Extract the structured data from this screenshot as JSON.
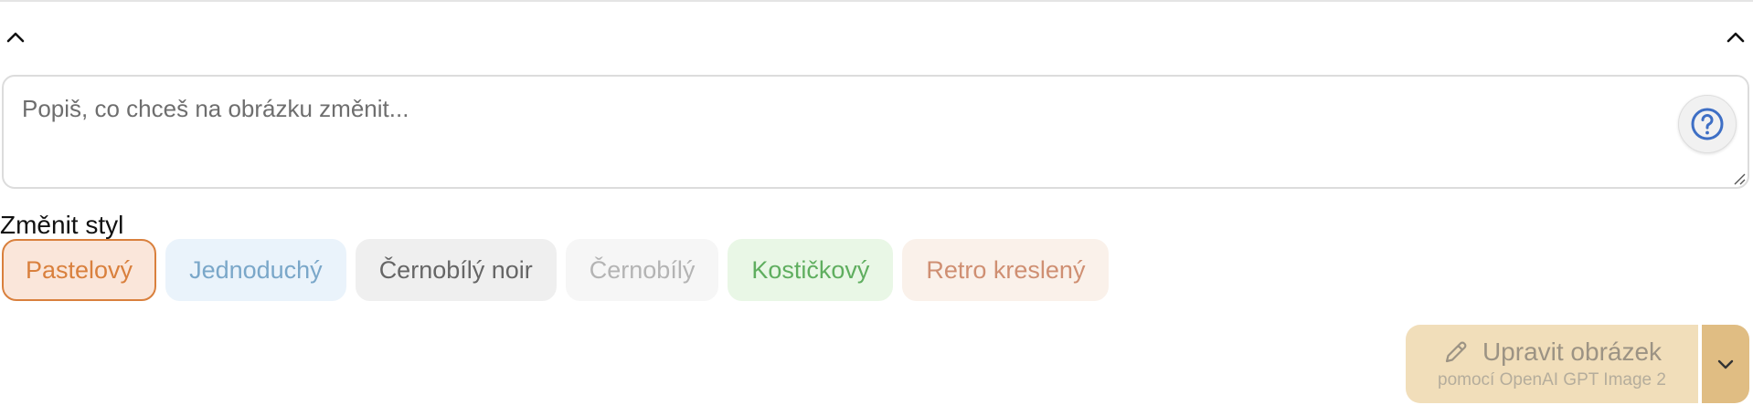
{
  "prompt": {
    "placeholder": "Popiš, co chceš na obrázku změnit...",
    "value": ""
  },
  "style_section": {
    "label": "Změnit styl",
    "chips": [
      {
        "label": "Pastelový",
        "selected": true,
        "color": "#d9803d",
        "bg": "#fae6da",
        "border": "#d9803d"
      },
      {
        "label": "Jednoduchý",
        "selected": false,
        "color": "#7aa7c9",
        "bg": "#eaf3fb",
        "border": "#eaf3fb"
      },
      {
        "label": "Černobílý noir",
        "selected": false,
        "color": "#666666",
        "bg": "#efefef",
        "border": "#efefef"
      },
      {
        "label": "Černobílý",
        "selected": false,
        "color": "#b4b4b4",
        "bg": "#f6f6f6",
        "border": "#f6f6f6"
      },
      {
        "label": "Kostičkový",
        "selected": false,
        "color": "#5fae5f",
        "bg": "#e9f7e6",
        "border": "#e9f7e6"
      },
      {
        "label": "Retro kreslený",
        "selected": false,
        "color": "#cf8f72",
        "bg": "#faf1ea",
        "border": "#faf1ea"
      }
    ]
  },
  "submit": {
    "label": "Upravit obrázek",
    "sublabel": "pomocí OpenAI GPT Image 2",
    "icon": "pencil-icon",
    "menu_icon": "chevron-down-icon"
  },
  "colors": {
    "accent": "#e0bd83",
    "help_icon": "#3e6fc5"
  }
}
